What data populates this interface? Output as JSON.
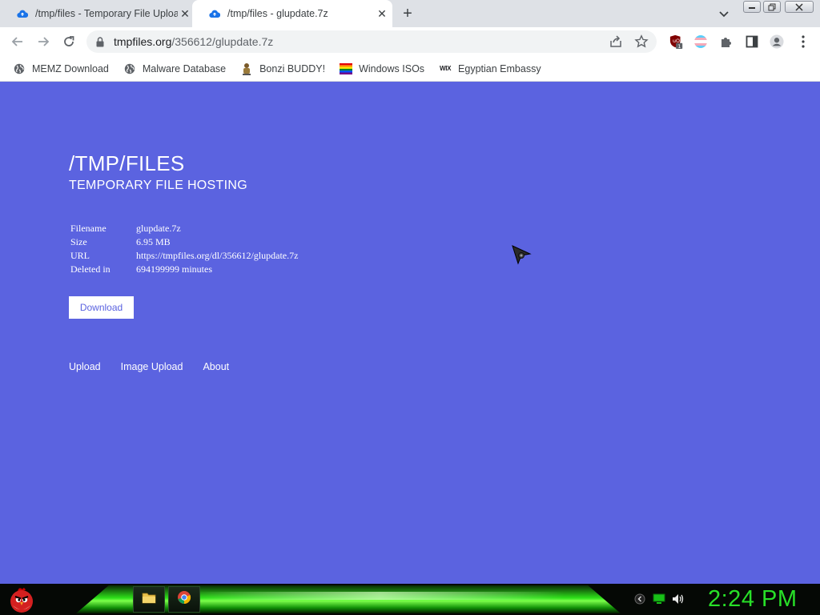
{
  "browser": {
    "tabs": [
      {
        "title": "/tmp/files - Temporary File Upload",
        "close": "✕"
      },
      {
        "title": "/tmp/files - glupdate.7z",
        "close": "✕"
      }
    ],
    "new_tab": "+",
    "url_domain": "tmpfiles.org",
    "url_path": "/356612/glupdate.7z",
    "ublock_badge": "1",
    "bookmarks": [
      {
        "label": "MEMZ Download",
        "icon": "globe-icon"
      },
      {
        "label": "Malware Database",
        "icon": "globe-icon"
      },
      {
        "label": "Bonzi BUDDY!",
        "icon": "bonzi-icon"
      },
      {
        "label": "Windows ISOs",
        "icon": "rainbow-flag-icon"
      },
      {
        "label": "Egyptian Embassy",
        "icon": "wix-icon"
      }
    ],
    "wix_text": "WIX"
  },
  "page": {
    "title": "/TMP/FILES",
    "subtitle": "TEMPORARY FILE HOSTING",
    "info": [
      {
        "key": "Filename",
        "value": "glupdate.7z"
      },
      {
        "key": "Size",
        "value": "6.95 MB"
      },
      {
        "key": "URL",
        "value": "https://tmpfiles.org/dl/356612/glupdate.7z"
      },
      {
        "key": "Deleted in",
        "value": "694199999 minutes"
      }
    ],
    "download_label": "Download",
    "footer_links": [
      "Upload",
      "Image Upload",
      "About"
    ],
    "background_color": "#5b63e0"
  },
  "taskbar": {
    "clock": "2:24 PM",
    "accent_color": "#28e028"
  }
}
